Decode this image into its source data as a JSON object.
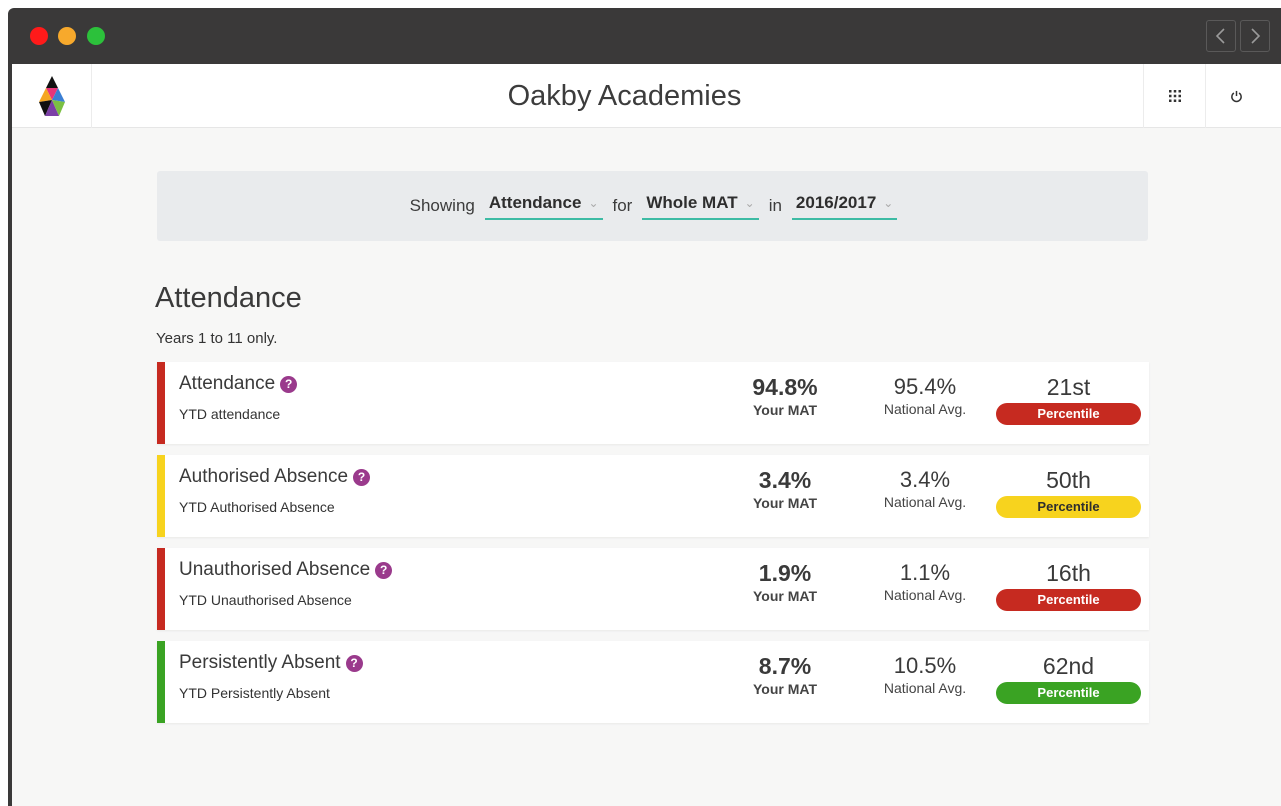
{
  "app": {
    "title": "Oakby Academies"
  },
  "filter": {
    "showing_label": "Showing",
    "measure": "Attendance",
    "for_label": "for",
    "scope": "Whole MAT",
    "in_label": "in",
    "year": "2016/2017"
  },
  "section": {
    "title": "Attendance",
    "subtitle": "Years 1 to 11 only."
  },
  "cards": [
    {
      "name": "Attendance",
      "desc": "YTD attendance",
      "mine": "94.8%",
      "mine_label": "Your MAT",
      "national": "95.4%",
      "national_label": "National Avg.",
      "percentile": "21st",
      "percentile_label": "Percentile",
      "status": "red"
    },
    {
      "name": "Authorised Absence",
      "desc": "YTD Authorised Absence",
      "mine": "3.4%",
      "mine_label": "Your MAT",
      "national": "3.4%",
      "national_label": "National Avg.",
      "percentile": "50th",
      "percentile_label": "Percentile",
      "status": "yellow"
    },
    {
      "name": "Unauthorised Absence",
      "desc": "YTD Unauthorised Absence",
      "mine": "1.9%",
      "mine_label": "Your MAT",
      "national": "1.1%",
      "national_label": "National Avg.",
      "percentile": "16th",
      "percentile_label": "Percentile",
      "status": "red"
    },
    {
      "name": "Persistently Absent",
      "desc": "YTD Persistently Absent",
      "mine": "8.7%",
      "mine_label": "Your MAT",
      "national": "10.5%",
      "national_label": "National Avg.",
      "percentile": "62nd",
      "percentile_label": "Percentile",
      "status": "green"
    }
  ],
  "icons": {
    "help_glyph": "?",
    "caret_glyph": "⌄"
  },
  "colors": {
    "red": "#c62a20",
    "yellow": "#f7d31e",
    "green": "#3aa323",
    "accent": "#3dbba4",
    "help": "#9a3a8c"
  }
}
